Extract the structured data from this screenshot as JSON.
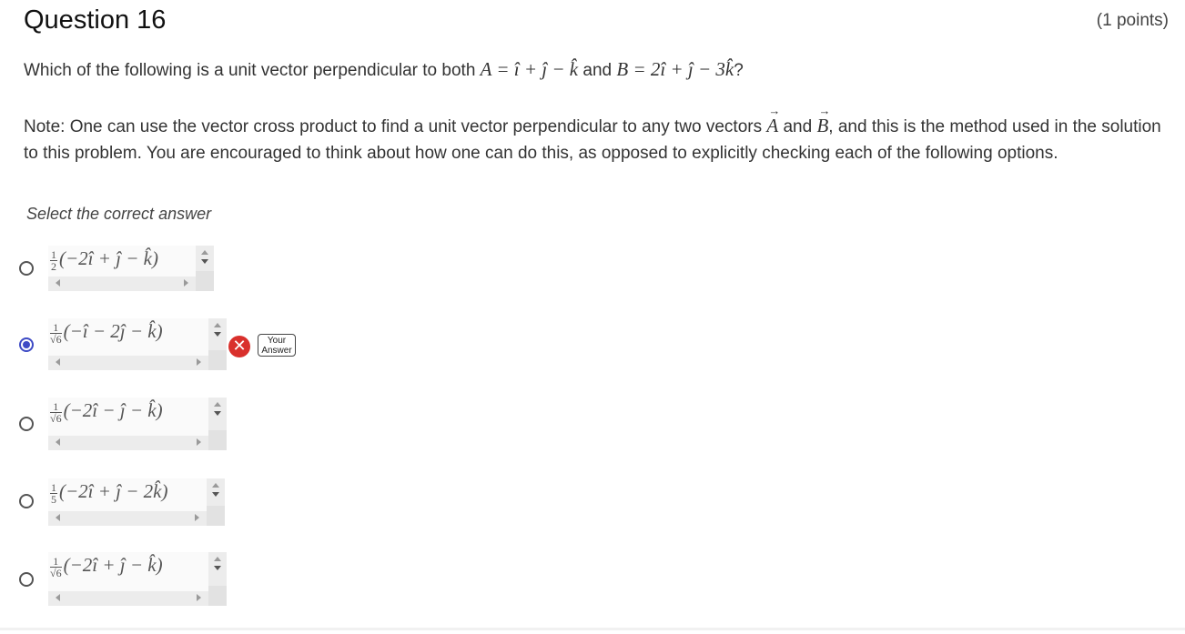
{
  "question": {
    "title": "Question 16",
    "points": "(1 points)",
    "text_prefix": "Which of the following is a unit vector perpendicular to both ",
    "vector_a": "A = î + ĵ − k̂",
    "conjunction": " and ",
    "vector_b": "B = 2î + ĵ − 3k̂",
    "text_suffix": "?",
    "note_part1": "Note: One can use the vector cross product to find a unit vector perpendicular to any two vectors ",
    "note_vec_a": "A",
    "note_and": " and ",
    "note_vec_b": "B",
    "note_part2": ", and this is the method used in the solution to this problem.  You are encouraged to think about how one can do this, as opposed to explicitly checking each of the following options.",
    "select_label": "Select the correct answer"
  },
  "options": [
    {
      "coef_num": "1",
      "coef_den": "2",
      "expr": "(−2î + ĵ − k̂)",
      "selected": false
    },
    {
      "coef_num": "1",
      "coef_den": "√6",
      "expr": "(−î − 2ĵ − k̂)",
      "selected": true
    },
    {
      "coef_num": "1",
      "coef_den": "√6",
      "expr": "(−2î − ĵ − k̂)",
      "selected": false
    },
    {
      "coef_num": "1",
      "coef_den": "5",
      "expr": "(−2î + ĵ − 2k̂)",
      "selected": false
    },
    {
      "coef_num": "1",
      "coef_den": "√6",
      "expr": "(−2î + ĵ − k̂)",
      "selected": false
    }
  ],
  "feedback": {
    "incorrect_icon": "close-icon",
    "incorrect_symbol": "✕",
    "your_answer_line1": "Your",
    "your_answer_line2": "Answer"
  },
  "colors": {
    "selected_radio": "#3e4bc5",
    "incorrect": "#d9302c"
  }
}
